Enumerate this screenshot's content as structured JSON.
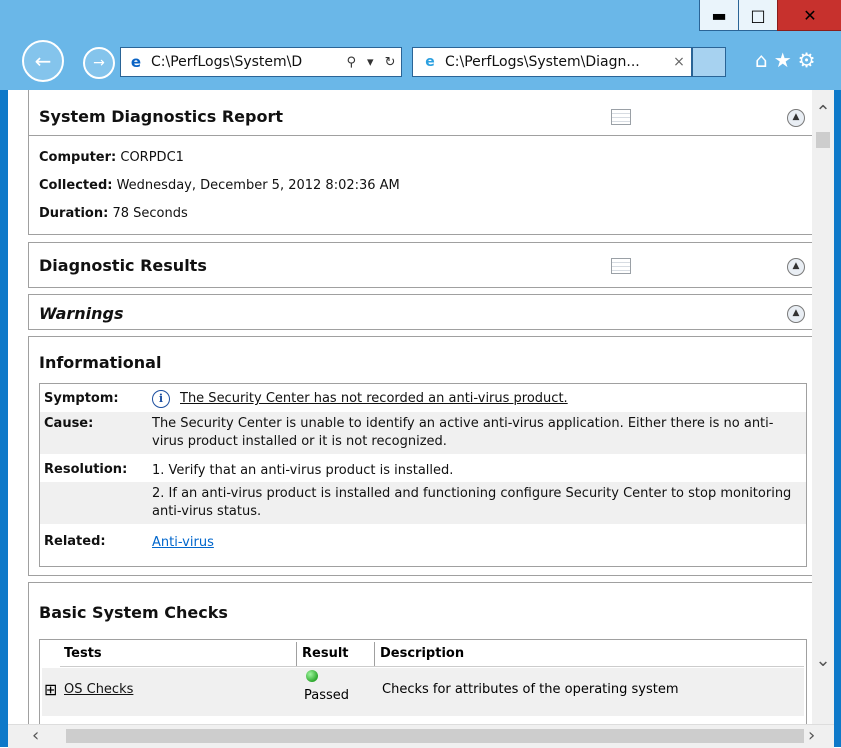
{
  "window": {
    "minimize": "▬",
    "maximize": "□",
    "close": "✕"
  },
  "nav": {
    "address": "C:\\PerfLogs\\System\\D",
    "tab_title": "C:\\PerfLogs\\System\\Diagn...",
    "tab_close": "×"
  },
  "report": {
    "title": "System Diagnostics Report",
    "computer_label": "Computer:",
    "computer": "CORPDC1",
    "collected_label": "Collected:",
    "collected": "Wednesday, December 5, 2012 8:02:36 AM",
    "duration_label": "Duration:",
    "duration": "78 Seconds"
  },
  "diagnostic_results": {
    "title": "Diagnostic Results"
  },
  "warnings": {
    "title": "Warnings"
  },
  "informational": {
    "title": "Informational",
    "symptom_label": "Symptom:",
    "symptom": "The Security Center has not recorded an anti-virus product.",
    "cause_label": "Cause:",
    "cause": "The Security Center is unable to identify an active anti-virus application. Either there is no anti-virus product installed or it is not recognized.",
    "resolution_label": "Resolution:",
    "resolution_1": "1. Verify that an anti-virus product is installed.",
    "resolution_2": "2. If an anti-virus product is installed and functioning configure Security Center to stop monitoring anti-virus status.",
    "related_label": "Related:",
    "related": "Anti-virus"
  },
  "basic_checks": {
    "title": "Basic System Checks",
    "headers": {
      "tests": "Tests",
      "result": "Result",
      "description": "Description"
    },
    "rows": [
      {
        "expander": "⊞",
        "test": "OS Checks",
        "result": "Passed",
        "description": "Checks for attributes of the operating system"
      }
    ]
  },
  "colors": {
    "frame": "#6ab7e8",
    "close": "#c7312d",
    "link": "#0066cc",
    "pass": "#2ea82e"
  }
}
